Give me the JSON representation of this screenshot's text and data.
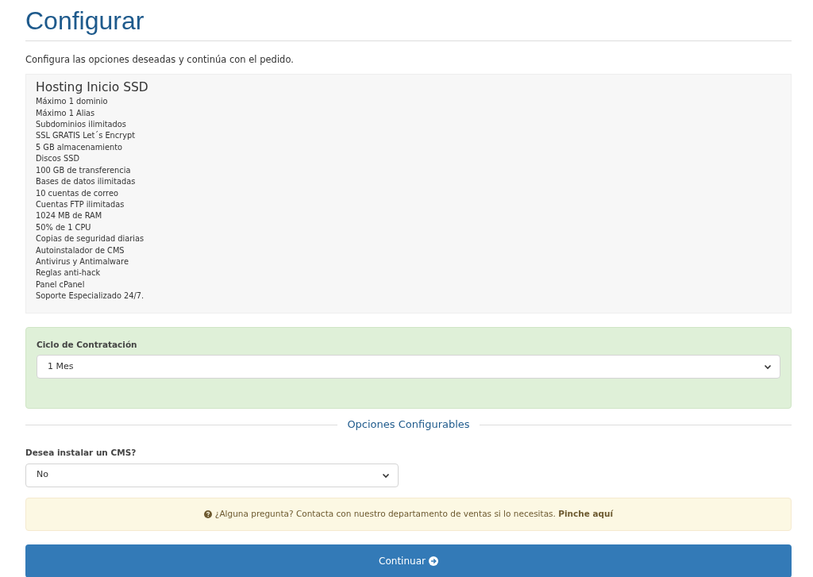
{
  "page": {
    "title": "Configurar",
    "description": "Configura las opciones deseadas y continúa con el pedido."
  },
  "product": {
    "name": "Hosting Inicio SSD",
    "features": [
      "Máximo 1 dominio",
      "Máximo 1 Alias",
      "Subdominios ilimitados",
      "SSL GRATIS Let´s Encrypt",
      "5 GB almacenamiento",
      "Discos SSD",
      "100 GB de transferencia",
      "Bases de datos ilimitadas",
      "10 cuentas de correo",
      "Cuentas FTP ilimitadas",
      "1024 MB de RAM",
      "50% de 1 CPU",
      "Copias de seguridad diarias",
      "Autoinstalador de CMS",
      "Antivirus y Antimalware",
      "Reglas anti-hack",
      "Panel cPanel",
      "Soporte Especializado 24/7."
    ]
  },
  "billing_cycle": {
    "label": "Ciclo de Contratación",
    "value": "1 Mes"
  },
  "section_heading": "Opciones Configurables",
  "options": [
    {
      "label": "Desea instalar un CMS?",
      "value": "No"
    }
  ],
  "notice": {
    "text": "¿Alguna pregunta? Contacta con nuestro departamento de ventas si lo necesitas.",
    "link": "Pinche aquí"
  },
  "submit_button": "Continuar"
}
